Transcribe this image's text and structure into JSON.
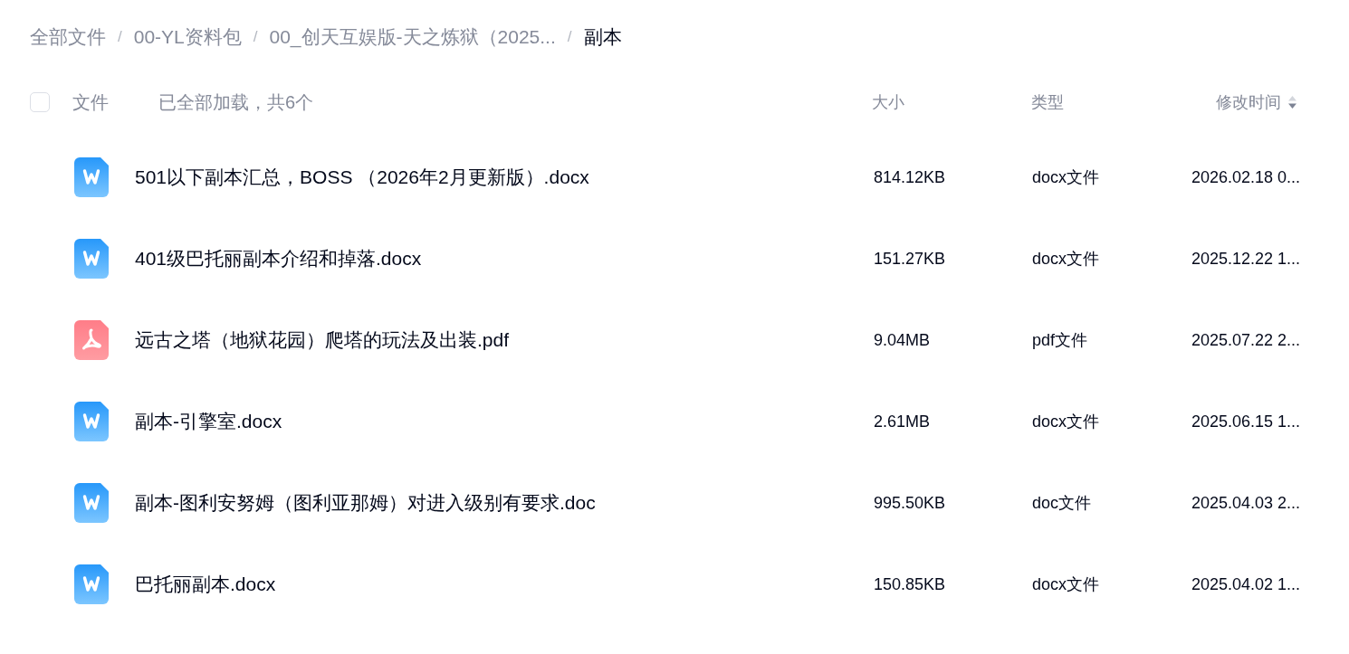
{
  "breadcrumb": [
    {
      "label": "全部文件",
      "current": false,
      "separator": "/"
    },
    {
      "label": "00-YL资料包",
      "current": false,
      "separator": "/"
    },
    {
      "label": "00_创天互娱版-天之炼狱（2025...",
      "current": false,
      "separator": "/"
    },
    {
      "label": "副本",
      "current": true
    }
  ],
  "file_list": {
    "select_all": {
      "checked": false
    },
    "header": {
      "name": "文件",
      "status": "已全部加载，共6个",
      "columns": [
        {
          "label": "大小",
          "sorted": false
        },
        {
          "label": "类型",
          "sorted": false
        },
        {
          "label": "修改时间",
          "sorted": true
        }
      ]
    },
    "rows": [
      {
        "kind": "word",
        "name": "501以下副本汇总，BOSS （2026年2月更新版）.docx",
        "size": "814.12KB",
        "type": "docx文件",
        "modified": "2026.02.18 0..."
      },
      {
        "kind": "word",
        "name": "401级巴托丽副本介绍和掉落.docx",
        "size": "151.27KB",
        "type": "docx文件",
        "modified": "2025.12.22 1..."
      },
      {
        "kind": "pdf",
        "name": "远古之塔（地狱花园）爬塔的玩法及出装.pdf",
        "size": "9.04MB",
        "type": "pdf文件",
        "modified": "2025.07.22 2..."
      },
      {
        "kind": "word",
        "name": "副本-引擎室.docx",
        "size": "2.61MB",
        "type": "docx文件",
        "modified": "2025.06.15 1..."
      },
      {
        "kind": "word",
        "name": "副本-图利安努姆（图利亚那姆）对进入级别有要求.doc",
        "size": "995.50KB",
        "type": "doc文件",
        "modified": "2025.04.03 2..."
      },
      {
        "kind": "word",
        "name": "巴托丽副本.docx",
        "size": "150.85KB",
        "type": "docx文件",
        "modified": "2025.04.02 1..."
      }
    ]
  }
}
